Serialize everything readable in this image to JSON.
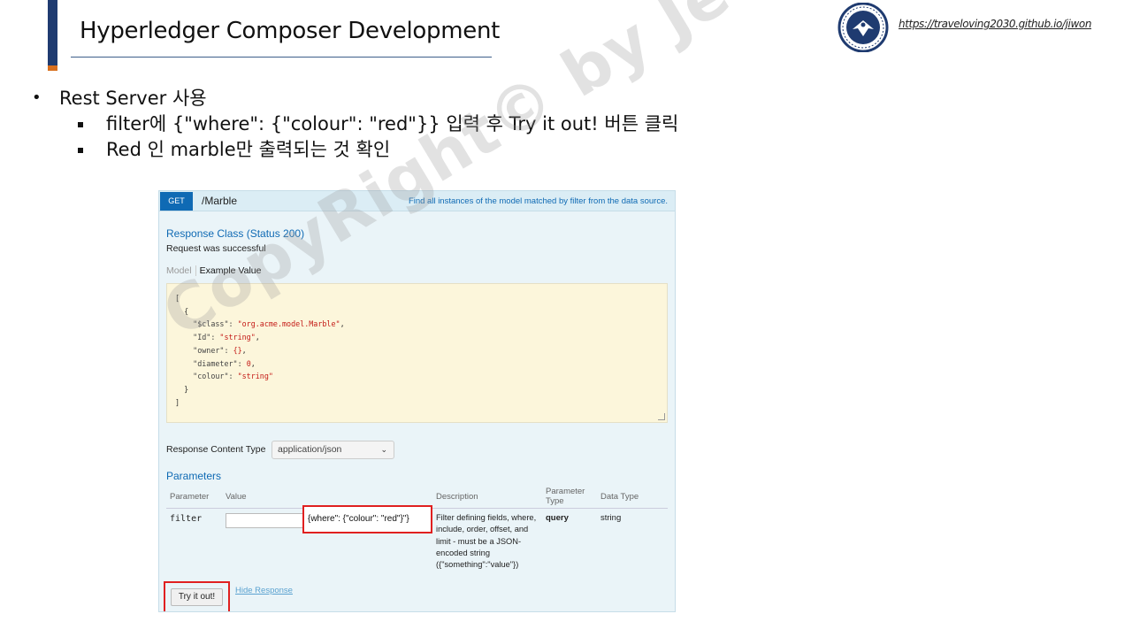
{
  "slide": {
    "title": "Hyperledger Composer Development",
    "site_link": "https://traveloving2030.github.io/jiwon",
    "logo_icon": "university-seal-logo"
  },
  "bullets": {
    "main": "Rest Server 사용",
    "sub": [
      "filter에 {\"where\": {\"colour\": \"red\"}}  입력 후 Try it out! 버튼 클릭",
      "Red 인 marble만 출력되는 것 확인"
    ]
  },
  "swagger": {
    "method": "GET",
    "path": "/Marble",
    "summary": "Find all instances of the model matched by filter from the data source.",
    "response_class": "Response Class (Status 200)",
    "response_message": "Request was successful",
    "tab_model": "Model",
    "tab_example": "Example Value",
    "example_lines": [
      {
        "text": "["
      },
      {
        "text": "  {"
      },
      {
        "key": "    \"$class\": ",
        "val": "\"org.acme.model.Marble\"",
        "end": ","
      },
      {
        "key": "    \"Id\": ",
        "val": "\"string\"",
        "end": ","
      },
      {
        "key": "    \"owner\": ",
        "val": "{}",
        "end": ","
      },
      {
        "key": "    \"diameter\": ",
        "val": "0",
        "end": ","
      },
      {
        "key": "    \"colour\": ",
        "val": "\"string\"",
        "end": ""
      },
      {
        "text": "  }"
      },
      {
        "text": "]"
      }
    ],
    "response_content_type_label": "Response Content Type",
    "response_content_type_value": "application/json",
    "parameters_title": "Parameters",
    "columns": {
      "parameter": "Parameter",
      "value": "Value",
      "description": "Description",
      "parameter_type": "Parameter Type",
      "data_type": "Data Type"
    },
    "param": {
      "name": "filter",
      "value": "{where\": {\"colour\": \"red\"}\"}",
      "description": "Filter defining fields, where, include, order, offset, and limit - must be a JSON-encoded string ({\"something\":\"value\"})",
      "param_type": "query",
      "data_type": "string"
    },
    "try_button": "Try it out!",
    "hide_response": "Hide Response"
  },
  "watermark": "CopyRight© by Jeong JiWon",
  "colors": {
    "accent_navy": "#1f3b70",
    "accent_orange": "#d76f1e",
    "get_blue": "#0f6ab4",
    "highlight_red": "#e02020",
    "code_bg": "#fcf6db"
  }
}
